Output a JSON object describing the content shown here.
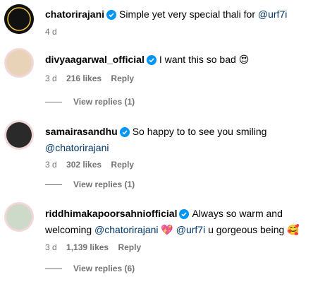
{
  "comments": [
    {
      "username": "chatorirajani",
      "text": "Simple yet very special thali for ",
      "mention": "@urf7i",
      "time": "4 d",
      "avatar_text": "CHATORI RAJANI"
    },
    {
      "username": "divyaagarwal_official",
      "text": "I want this so bad ",
      "emoji": "😍",
      "time": "3 d",
      "likes": "216 likes",
      "reply": "Reply",
      "view_replies": "View replies (1)"
    },
    {
      "username": "samairasandhu",
      "text": "So happy to to see you smiling",
      "mention": "@chatorirajani",
      "time": "3 d",
      "likes": "302 likes",
      "reply": "Reply",
      "view_replies": "View replies (1)"
    },
    {
      "username": "riddhimakapoorsahniofficial",
      "text": "Always so warm and welcoming ",
      "mention": "@chatorirajani",
      "emoji1": "💖",
      "mention2": "@urf7i",
      "text2": " u gorgeous being ",
      "emoji2": "🥰",
      "time": "3 d",
      "likes": "1,139 likes",
      "reply": "Reply",
      "view_replies": "View replies (6)"
    }
  ],
  "colors": {
    "verified": "#0095f6",
    "mention": "#00376b",
    "meta": "#737373"
  }
}
